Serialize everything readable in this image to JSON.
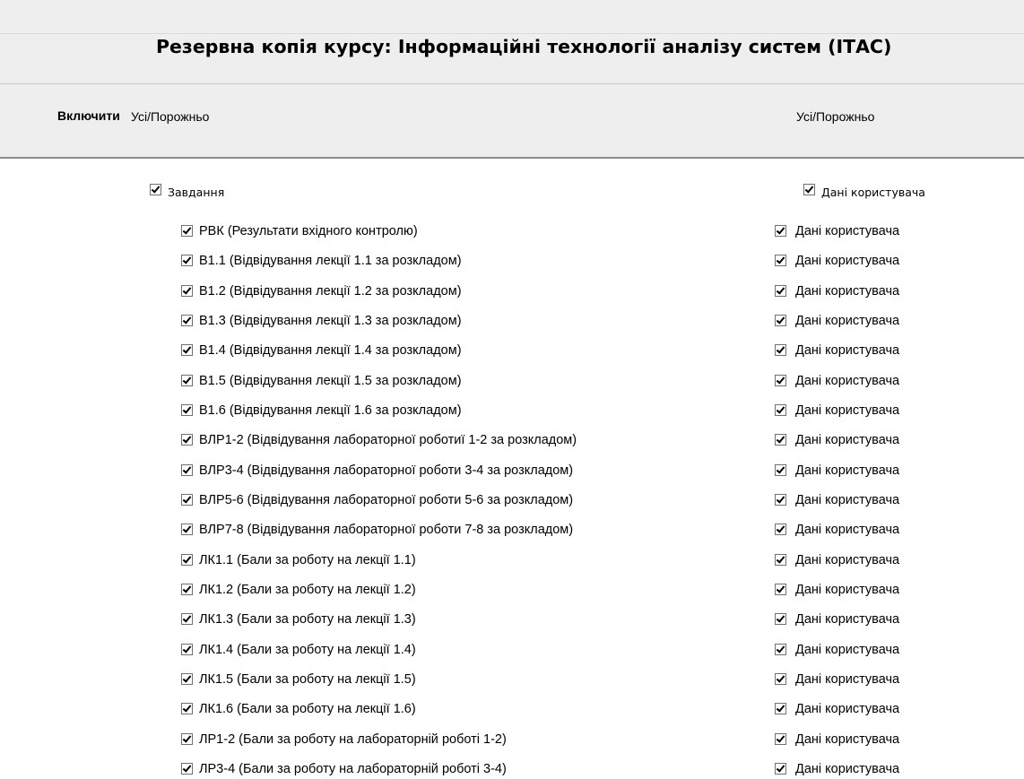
{
  "page": {
    "title": "Резервна копія курсу: Інформаційні технології аналізу систем (ІТАС)"
  },
  "controls": {
    "include_label": "Включити",
    "all_none_left": "Усі/Порожньо",
    "all_none_right": "Усі/Порожньо"
  },
  "section": {
    "label": "Завдання",
    "checked": true,
    "user_data_label": "Дані користувача",
    "user_data_checked": true
  },
  "items": [
    {
      "label": "РВК (Результати вхідного контролю)",
      "checked": true,
      "user_data": "Дані користувача",
      "user_data_checked": true
    },
    {
      "label": "В1.1 (Відвідування лекції 1.1 за розкладом)",
      "checked": true,
      "user_data": "Дані користувача",
      "user_data_checked": true
    },
    {
      "label": "В1.2 (Відвідування лекції 1.2 за розкладом)",
      "checked": true,
      "user_data": "Дані користувача",
      "user_data_checked": true
    },
    {
      "label": "В1.3 (Відвідування лекції 1.3 за розкладом)",
      "checked": true,
      "user_data": "Дані користувача",
      "user_data_checked": true
    },
    {
      "label": "В1.4 (Відвідування лекції 1.4 за розкладом)",
      "checked": true,
      "user_data": "Дані користувача",
      "user_data_checked": true
    },
    {
      "label": "В1.5 (Відвідування лекції 1.5 за розкладом)",
      "checked": true,
      "user_data": "Дані користувача",
      "user_data_checked": true
    },
    {
      "label": "В1.6 (Відвідування лекції 1.6 за розкладом)",
      "checked": true,
      "user_data": "Дані користувача",
      "user_data_checked": true
    },
    {
      "label": "ВЛР1-2 (Відвідування лабораторної роботиї 1-2 за розкладом)",
      "checked": true,
      "user_data": "Дані користувача",
      "user_data_checked": true
    },
    {
      "label": "ВЛР3-4 (Відвідування лабораторної роботи 3-4 за розкладом)",
      "checked": true,
      "user_data": "Дані користувача",
      "user_data_checked": true
    },
    {
      "label": "ВЛР5-6 (Відвідування лабораторної роботи 5-6 за розкладом)",
      "checked": true,
      "user_data": "Дані користувача",
      "user_data_checked": true
    },
    {
      "label": "ВЛР7-8 (Відвідування лабораторної роботи 7-8 за розкладом)",
      "checked": true,
      "user_data": "Дані користувача",
      "user_data_checked": true
    },
    {
      "label": "ЛК1.1 (Бали за роботу на лекції 1.1)",
      "checked": true,
      "user_data": "Дані користувача",
      "user_data_checked": true
    },
    {
      "label": "ЛК1.2 (Бали за роботу на лекції 1.2)",
      "checked": true,
      "user_data": "Дані користувача",
      "user_data_checked": true
    },
    {
      "label": "ЛК1.3 (Бали за роботу на лекції 1.3)",
      "checked": true,
      "user_data": "Дані користувача",
      "user_data_checked": true
    },
    {
      "label": "ЛК1.4 (Бали за роботу на лекції 1.4)",
      "checked": true,
      "user_data": "Дані користувача",
      "user_data_checked": true
    },
    {
      "label": "ЛК1.5 (Бали за роботу на лекції 1.5)",
      "checked": true,
      "user_data": "Дані користувача",
      "user_data_checked": true
    },
    {
      "label": "ЛК1.6 (Бали за роботу на лекції 1.6)",
      "checked": true,
      "user_data": "Дані користувача",
      "user_data_checked": true
    },
    {
      "label": "ЛР1-2 (Бали за роботу на лабораторній роботі 1-2)",
      "checked": true,
      "user_data": "Дані користувача",
      "user_data_checked": true
    },
    {
      "label": "ЛР3-4 (Бали за роботу на лабораторній роботі 3-4)",
      "checked": true,
      "user_data": "Дані користувача",
      "user_data_checked": true
    }
  ]
}
